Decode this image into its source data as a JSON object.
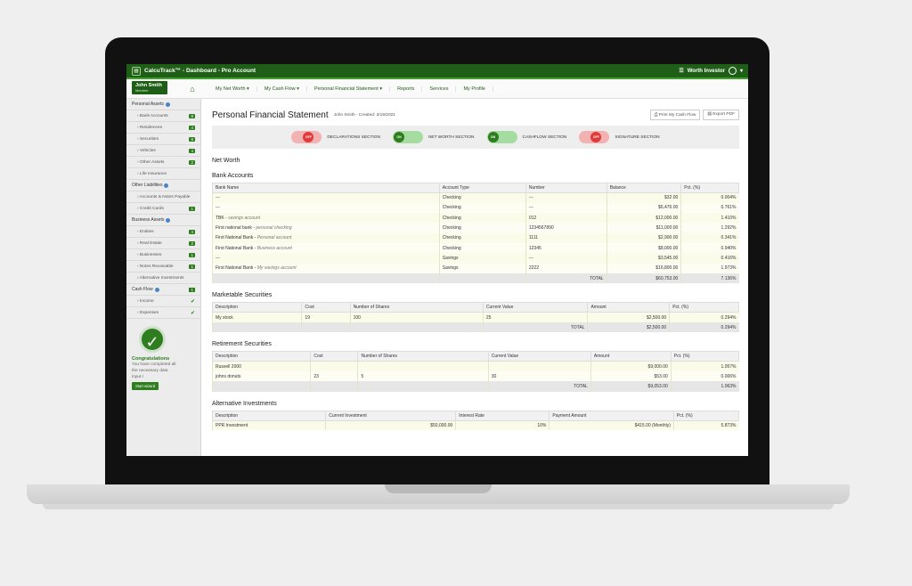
{
  "app": {
    "title": "CalcuTrack™ - Dashboard - Pro Account",
    "user_menu": "Worth Investor"
  },
  "user": {
    "name": "John Smith",
    "role": "Member"
  },
  "nav": [
    "My Net Worth ▾",
    "My Cash Flow ▾",
    "Personal Financial Statement ▾",
    "Reports",
    "Services",
    "My Profile"
  ],
  "sidebar": {
    "groups": [
      {
        "label": "Personal Assets",
        "items": [
          {
            "label": "› Bank Accounts",
            "count": "8"
          },
          {
            "label": "› Residences",
            "count": "4"
          },
          {
            "label": "› Securities",
            "count": "8"
          },
          {
            "label": "› Vehicles",
            "count": "4"
          },
          {
            "label": "› Other Assets",
            "count": "2"
          },
          {
            "label": "› Life Insurance",
            "count": ""
          }
        ]
      },
      {
        "label": "Other Liabilities",
        "items": [
          {
            "label": "› Accounts & Notes Payable",
            "count": ""
          },
          {
            "label": "› Credit Cards",
            "count": "1"
          }
        ]
      },
      {
        "label": "Business Assets",
        "items": [
          {
            "label": "› Entities",
            "count": "4"
          },
          {
            "label": "› Real Estate",
            "count": "2"
          },
          {
            "label": "› Businesses",
            "count": "1"
          },
          {
            "label": "› Notes Receivable",
            "count": "1"
          },
          {
            "label": "› Alternative Investments",
            "count": ""
          }
        ]
      },
      {
        "label": "Cash Flow",
        "count": "1",
        "items": [
          {
            "label": "› Income",
            "check": true
          },
          {
            "label": "› Expenses",
            "check": true
          }
        ]
      }
    ],
    "congrats": {
      "title": "Congratulations",
      "text": "You have completed all the necessary data input.!",
      "button": "Start wizard"
    }
  },
  "page": {
    "title": "Personal Financial Statement",
    "meta": "John Smith - Created: 3/19/2021",
    "print_btn": "⎙ Print My Cash Flow",
    "export_btn": "▤ Export PDF",
    "sections": [
      {
        "label": "DECLARATIONS SECTION",
        "state": "OFF"
      },
      {
        "label": "NET WORTH SECTION",
        "state": "ON"
      },
      {
        "label": "CASHFLOW SECTION",
        "state": "ON"
      },
      {
        "label": "SIGNATURE SECTION",
        "state": "OFF"
      }
    ],
    "net_worth_heading": "Net Worth"
  },
  "bank_accounts": {
    "title": "Bank Accounts",
    "columns": [
      "Bank Name",
      "Account Type",
      "Number",
      "Balance",
      "Pct. (%)"
    ],
    "rows": [
      {
        "name": "---",
        "sub": "",
        "type": "Checking",
        "number": "---",
        "balance": "$32.00",
        "pct": "0.004%"
      },
      {
        "name": "---",
        "sub": "",
        "type": "Checking",
        "number": "---",
        "balance": "$6,476.00",
        "pct": "0.761%"
      },
      {
        "name": "TBK",
        "sub": "savings account",
        "type": "Checking",
        "number": "012",
        "balance": "$12,000.00",
        "pct": "1.410%"
      },
      {
        "name": "First national bank",
        "sub": "personal checking",
        "type": "Checking",
        "number": "1234567890",
        "balance": "$11,000.00",
        "pct": "1.292%"
      },
      {
        "name": "First National Bank",
        "sub": "Personal account",
        "type": "Checking",
        "number": "1111",
        "balance": "$2,900.00",
        "pct": "0.341%"
      },
      {
        "name": "First National Bank",
        "sub": "Business account",
        "type": "Checking",
        "number": "12345",
        "balance": "$8,000.00",
        "pct": "0.940%"
      },
      {
        "name": "---",
        "sub": "",
        "type": "Savings",
        "number": "---",
        "balance": "$3,545.00",
        "pct": "0.416%"
      },
      {
        "name": "First National Bank",
        "sub": "My savings account",
        "type": "Savings",
        "number": "2222",
        "balance": "$16,800.00",
        "pct": "1.973%"
      }
    ],
    "total_label": "TOTAL",
    "total_balance": "$60,753.00",
    "total_pct": "7.136%"
  },
  "marketable": {
    "title": "Marketable Securities",
    "columns": [
      "Description",
      "Cost",
      "Number of Shares",
      "Current Value",
      "Amount",
      "Pct. (%)"
    ],
    "rows": [
      {
        "desc": "My stock",
        "cost": "19",
        "shares": "100",
        "value": "25",
        "amount": "$2,500.00",
        "pct": "0.294%"
      }
    ],
    "total_label": "TOTAL",
    "total_amount": "$2,500.00",
    "total_pct": "0.294%"
  },
  "retirement": {
    "title": "Retirement Securities",
    "columns": [
      "Description",
      "Cost",
      "Number of Shares",
      "Current Value",
      "Amount",
      "Pct. (%)"
    ],
    "rows": [
      {
        "desc": "Russell 2000",
        "cost": "",
        "shares": "",
        "value": "",
        "amount": "$9,000.00",
        "pct": "1.057%"
      },
      {
        "desc": "johns donuts",
        "cost": "23",
        "shares": "5",
        "value": "30",
        "amount": "$53.00",
        "pct": "0.006%"
      }
    ],
    "total_label": "TOTAL",
    "total_amount": "$9,053.00",
    "total_pct": "1.063%"
  },
  "alternative": {
    "title": "Alternative Investments",
    "columns": [
      "Description",
      "Current Investment",
      "Interest Rate",
      "Payment Amount",
      "Pct. (%)"
    ],
    "rows": [
      {
        "desc": "PPR Investment",
        "investment": "$50,000.00",
        "rate": "10%",
        "payment": "$415.00 (Monthly)",
        "pct": "5.873%"
      }
    ]
  }
}
